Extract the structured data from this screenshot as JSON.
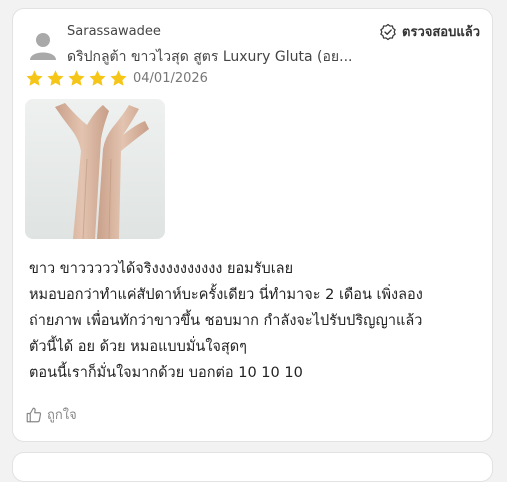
{
  "review": {
    "username": "Sarassawadee",
    "verified_label": "ตรวจสอบแล้ว",
    "product_name": "ดริปกลูต้า ขาวไวสุด สูตร Luxury Gluta (อย...",
    "rating": 5,
    "rating_max": 5,
    "date": "04/01/2026",
    "text_lines": [
      "ขาว ขาวววววได้จริงงงงงงงงงง ยอมรับเลย",
      "หมอบอกว่าทำแค่สัปดาห์บะครั้งเดียว นี่ทำมาจะ 2 เดือน เพิ่งลอง",
      "ถ่ายภาพ เพื่อนทักว่าขาวขึ้น ชอบมาก กำลังจะไปรับปริญญาแล้ว",
      "ตัวนี้ได้ อย ด้วย หมอแบบมั่นใจสุดๆ",
      "ตอนนี้เราก็มั่นใจมากด้วย บอกต่อ 10 10 10"
    ],
    "like_label": "ถูกใจ"
  },
  "icons": {
    "avatar": "user-avatar-icon",
    "verified": "verified-badge-icon",
    "star": "star-icon",
    "like": "thumbs-up-icon"
  },
  "colors": {
    "star": "#f5c518",
    "page_bg": "#f2f2f2",
    "card_bg": "#ffffff",
    "muted_text": "#888888"
  }
}
